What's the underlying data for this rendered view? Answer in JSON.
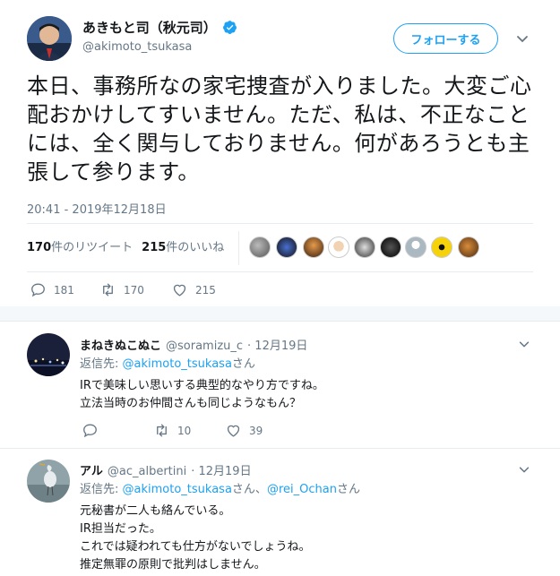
{
  "author": {
    "display_name": "あきもと司（秋元司）",
    "handle": "@akimoto_tsukasa"
  },
  "follow_button": {
    "label": "フォローする"
  },
  "tweet": {
    "text": "本日、事務所なの家宅捜査が入りました。大変ご心配おかけしてすいません。ただ、私は、不正なことには、全く関与しておりません。何があろうとも主張して参ります。",
    "timestamp": "20:41 - 2019年12月18日",
    "retweet_count": "170",
    "retweet_label": "件のリツイート",
    "like_count": "215",
    "like_label": "件のいいね",
    "actions": {
      "reply": "181",
      "retweet": "170",
      "like": "215"
    }
  },
  "replies": [
    {
      "name": "まねきぬこぬこ",
      "handle": "@soramizu_c",
      "date": "· 12月19日",
      "reply_to_prefix": "返信先:",
      "reply_to": [
        "@akimoto_tsukasa"
      ],
      "reply_to_suffix": [
        "さん"
      ],
      "lines": [
        "IRで美味しい思いする典型的なやり方ですね。",
        "立法当時のお仲間さんも同じようなもん？"
      ],
      "actions": {
        "reply": "",
        "retweet": "10",
        "like": "39"
      }
    },
    {
      "name": "アル",
      "handle": "@ac_albertini",
      "date": "· 12月19日",
      "reply_to_prefix": "返信先:",
      "reply_to": [
        "@akimoto_tsukasa",
        "@rei_Ochan"
      ],
      "reply_to_suffix": [
        "さん、",
        "さん"
      ],
      "lines": [
        "元秘書が二人も絡んでいる。",
        "IR担当だった。",
        "これでは疑われても仕方がないでしょうね。",
        "推定無罪の原則で批判はしません。"
      ]
    }
  ],
  "colors": {
    "accent": "#1da1f2",
    "muted": "#657786",
    "border": "#e6ecf0"
  }
}
